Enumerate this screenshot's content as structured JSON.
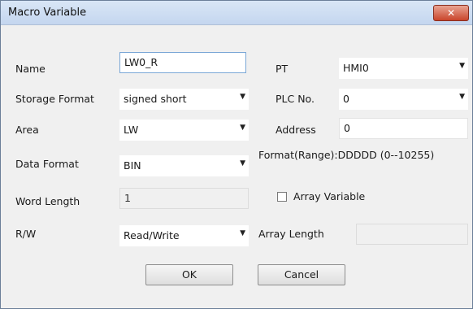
{
  "window": {
    "title": "Macro Variable",
    "close_label": "✕"
  },
  "labels": {
    "name": "Name",
    "storage_format": "Storage Format",
    "area": "Area",
    "data_format": "Data Format",
    "word_length": "Word Length",
    "rw": "R/W",
    "pt": "PT",
    "plc_no": "PLC No.",
    "address": "Address",
    "format_range": "Format(Range):DDDDD (0--10255)",
    "array_variable": "Array Variable",
    "array_length": "Array Length"
  },
  "fields": {
    "name_value": "LW0_R",
    "storage_format_value": "signed short",
    "area_value": "LW",
    "data_format_value": "BIN",
    "word_length_value": "1",
    "rw_value": "Read/Write",
    "pt_value": "HMI0",
    "plc_no_value": "0",
    "address_value": "0",
    "array_length_value": ""
  },
  "buttons": {
    "ok": "OK",
    "cancel": "Cancel"
  },
  "dropdown_arrow": "▼"
}
